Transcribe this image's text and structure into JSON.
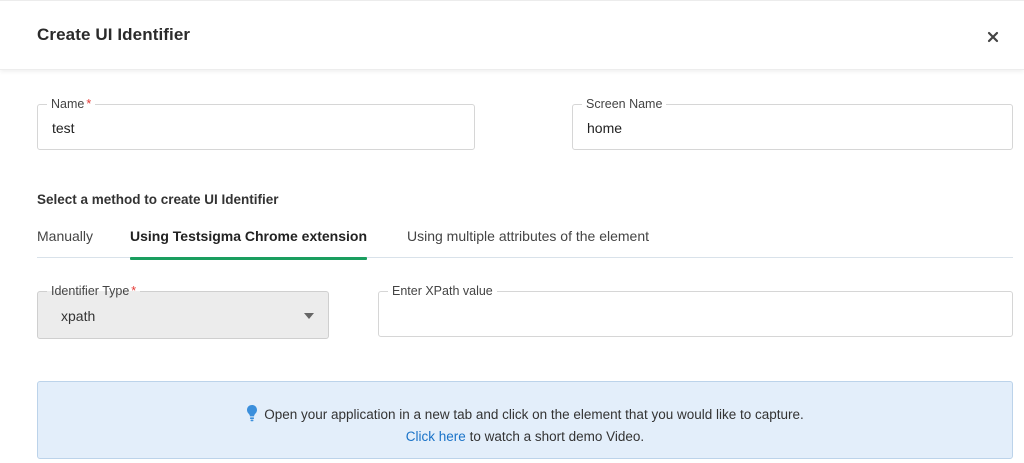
{
  "dialog": {
    "title": "Create UI Identifier"
  },
  "form": {
    "name": {
      "label": "Name",
      "required_mark": "*",
      "value": "test"
    },
    "screen_name": {
      "label": "Screen Name",
      "value": "home"
    }
  },
  "method": {
    "label": "Select a method to create UI Identifier",
    "tabs": [
      {
        "label": "Manually",
        "active": false
      },
      {
        "label": "Using Testsigma Chrome extension",
        "active": true
      },
      {
        "label": "Using multiple attributes of the element",
        "active": false
      }
    ]
  },
  "identifier": {
    "type_label": "Identifier Type",
    "required_mark": "*",
    "type_value": "xpath",
    "xpath_label": "Enter XPath value",
    "xpath_value": ""
  },
  "info": {
    "message": "Open your application in a new tab and click on the element that you would like to capture.",
    "link_text": "Click here",
    "link_suffix": " to watch a short demo Video."
  },
  "colors": {
    "accent": "#1a9e5f",
    "link": "#1a73c8",
    "required": "#e53935",
    "info_bg": "#e3eefa",
    "bulb": "#3b8fdc"
  }
}
